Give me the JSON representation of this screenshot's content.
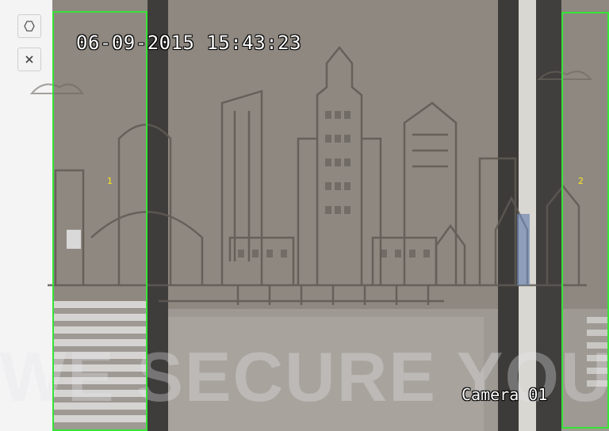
{
  "toolbar": {
    "items": [
      {
        "name": "polygon-draw-button",
        "icon": "hexagon-icon"
      },
      {
        "name": "clear-button",
        "icon": "close-icon"
      }
    ]
  },
  "video": {
    "timestamp": "06-09-2015 15:43:23",
    "camera_name": "Camera 01",
    "watermark": "WE SECURE YOUR LI"
  },
  "regions": [
    {
      "label": "1",
      "color": "#36e336"
    },
    {
      "label": "2",
      "color": "#36e336"
    }
  ],
  "colors": {
    "region_border": "#36e336",
    "region_label": "#ffe81a",
    "osd_text": "#ffffff"
  }
}
